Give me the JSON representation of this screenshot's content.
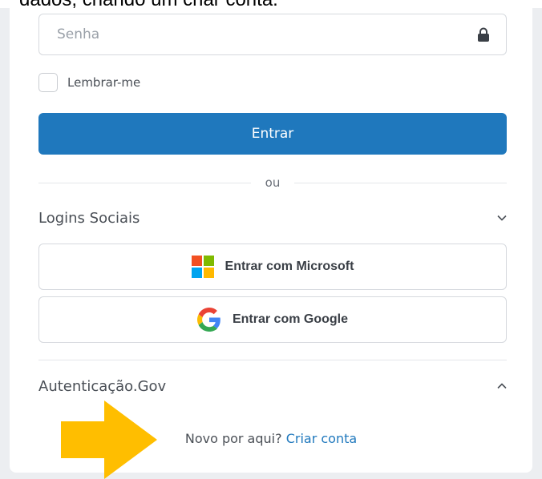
{
  "header": {
    "text": "dados, criando um criar conta."
  },
  "login": {
    "password_placeholder": "Senha",
    "remember_label": "Lembrar-me",
    "submit_label": "Entrar",
    "divider_text": "ou"
  },
  "social": {
    "title": "Logins Sociais",
    "microsoft_label": "Entrar com Microsoft",
    "google_label": "Entrar com Google"
  },
  "gov": {
    "title": "Autenticação.Gov"
  },
  "signup": {
    "prompt": "Novo por aqui?",
    "link": "Criar conta"
  },
  "colors": {
    "primary": "#1f78bd",
    "arrow": "#ffbe00",
    "ms_red": "#f25022",
    "ms_green": "#7fba00",
    "ms_blue": "#00a4ef",
    "ms_yellow": "#ffb900"
  }
}
